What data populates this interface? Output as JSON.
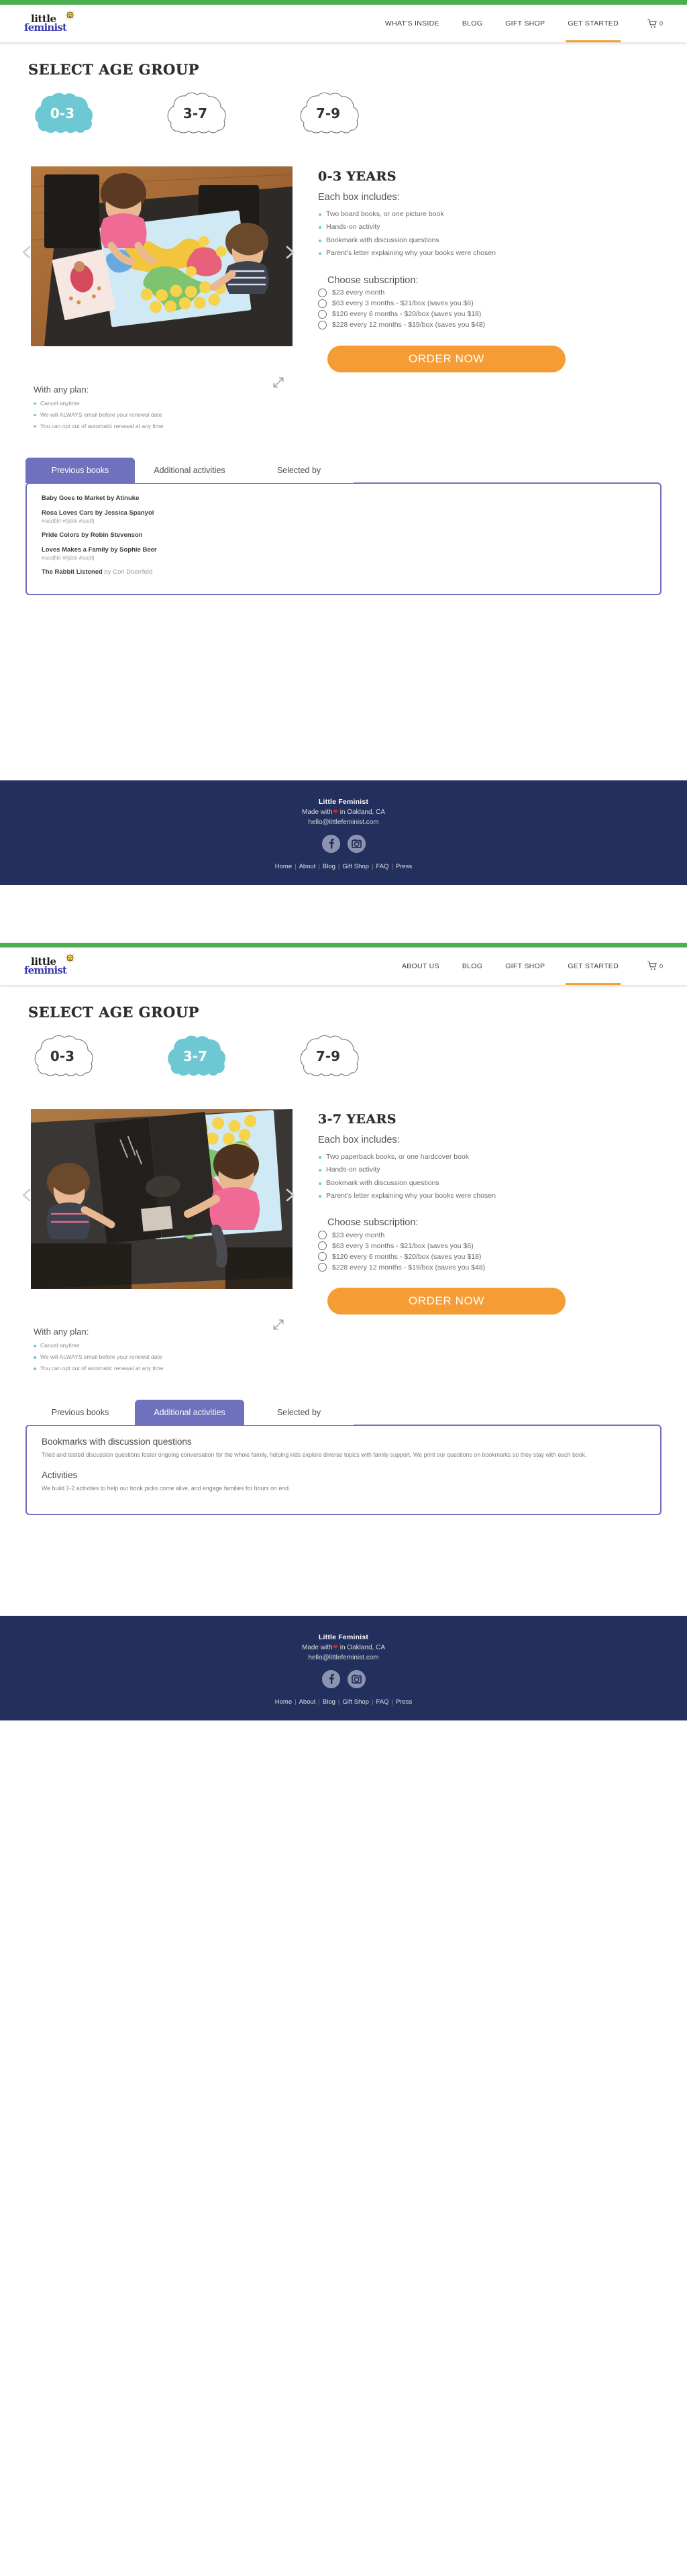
{
  "brand": {
    "name_line1": "little",
    "name_line2": "feminist",
    "sun_icon": "sun-icon"
  },
  "sections": [
    {
      "id": "section-0-3",
      "nav": {
        "items": [
          {
            "label": "WHAT'S INSIDE",
            "active": false
          },
          {
            "label": "BLOG",
            "active": false
          },
          {
            "label": "GIFT SHOP",
            "active": false
          },
          {
            "label": "GET STARTED",
            "active": true
          }
        ],
        "cart_icon": "cart-icon",
        "cart_count": "0"
      },
      "select_title": "SELECT AGE GROUP",
      "age_groups": [
        {
          "label": "0-3",
          "selected": true
        },
        {
          "label": "3-7",
          "selected": false
        },
        {
          "label": "7-9",
          "selected": false
        }
      ],
      "gallery": {
        "prev_icon": "chevron-left-icon",
        "next_icon": "chevron-right-icon",
        "expand_icon": "expand-icon",
        "alt": "Two toddlers at a dark table playing with a colorful world map activity poster and a picture book"
      },
      "product": {
        "title": "0-3 YEARS",
        "subhead": "Each box includes:",
        "features": [
          "Two board books, or one picture book",
          "Hands-on activity",
          "Bookmark with discussion questions",
          "Parent's letter explaining why your books were chosen"
        ],
        "choose_label": "Choose subscription:",
        "plans": [
          {
            "label": "$23 every month",
            "selected": false
          },
          {
            "label": "$63 every 3 months - $21/box (saves you $6)",
            "selected": false
          },
          {
            "label": "$120 every 6 months  - $20/box (saves you $18)",
            "selected": false
          },
          {
            "label": "$228 every 12 months - $19/box (saves you $48)",
            "selected": false
          }
        ],
        "order_label": "ORDER NOW"
      },
      "anyplan": {
        "title": "With any plan:",
        "items": [
          "Cancel anytime",
          "We will ALWAYS email before your renewal date",
          "You can opt out of automatic renewal at any time"
        ]
      },
      "tabs": [
        {
          "label": "Previous books",
          "active": true
        },
        {
          "label": "Additional activities",
          "active": false
        },
        {
          "label": "Selected by",
          "active": false
        }
      ],
      "panel_kind": "books",
      "books": [
        {
          "title": "Baby Goes to Market by Atinuke",
          "tags": ""
        },
        {
          "title": "Rosa Loves Cars by Jessica Spanyol",
          "tags": "#asdfjkl #fjdsk #asdfj"
        },
        {
          "title": "Pride Colors by Robin Stevenson",
          "tags": ""
        },
        {
          "title": "Loves Makes a Family by Sophie Beer",
          "tags": "#asdfjkl #fjdsk #asdfj"
        },
        {
          "title": "The Rabbit Listened",
          "by": " by Cori Doerrfeld",
          "tags": ""
        }
      ]
    },
    {
      "id": "section-3-7",
      "nav": {
        "items": [
          {
            "label": "ABOUT US",
            "active": false
          },
          {
            "label": "BLOG",
            "active": false
          },
          {
            "label": "GIFT SHOP",
            "active": false
          },
          {
            "label": "GET STARTED",
            "active": true
          }
        ],
        "cart_icon": "cart-icon",
        "cart_count": "0"
      },
      "select_title": "SELECT AGE GROUP",
      "age_groups": [
        {
          "label": "0-3",
          "selected": false
        },
        {
          "label": "3-7",
          "selected": true
        },
        {
          "label": "7-9",
          "selected": false
        }
      ],
      "gallery": {
        "prev_icon": "chevron-left-icon",
        "next_icon": "chevron-right-icon",
        "expand_icon": "expand-icon",
        "alt": "Two children at a dark table with an open hardcover book and a colorful world map activity poster"
      },
      "product": {
        "title": "3-7 YEARS",
        "subhead": "Each box includes:",
        "features": [
          "Two paperback books, or one hardcover book",
          "Hands-on activity",
          "Bookmark with discussion questions",
          "Parent's letter explaining why your books were chosen"
        ],
        "choose_label": "Choose subscription:",
        "plans": [
          {
            "label": "$23 every month",
            "selected": false
          },
          {
            "label": "$63 every 3 months - $21/box (saves you $6)",
            "selected": false
          },
          {
            "label": "$120 every 6 months  - $20/box (saves you $18)",
            "selected": false
          },
          {
            "label": "$228 every 12 months - $19/box (saves you $48)",
            "selected": false
          }
        ],
        "order_label": "ORDER NOW"
      },
      "anyplan": {
        "title": "With any plan:",
        "items": [
          "Cancel anytime",
          "We will ALWAYS email before your renewal date",
          "You can opt out of automatic renewal at any time"
        ]
      },
      "tabs": [
        {
          "label": "Previous books",
          "active": false
        },
        {
          "label": "Additional activities",
          "active": true
        },
        {
          "label": "Selected by",
          "active": false
        }
      ],
      "panel_kind": "activities",
      "activities": [
        {
          "heading": "Bookmarks with discussion questions",
          "body": "Tried and tested discussion questions foster ongoing conversation for the whole family, helping kids explore diverse topics with family support. We print our questions on bookmarks so they stay with each book."
        },
        {
          "heading": "Activities",
          "body": "We build 1-2 activities to help our book picks come alive, and engage families for hours on end."
        }
      ]
    }
  ],
  "footer": {
    "brand": "Little Feminist",
    "made_with_prefix": "Made with",
    "heart_icon": "heart-icon",
    "made_with_suffix": "in Oakland, CA",
    "email": "hello@littlefeminist.com",
    "social": [
      {
        "name": "facebook-icon"
      },
      {
        "name": "instagram-icon"
      }
    ],
    "links": [
      "Home",
      "About",
      "Blog",
      "Gift Shop",
      "FAQ",
      "Press"
    ]
  },
  "colors": {
    "green_bar": "#4CAF50",
    "accent_orange": "#F59C35",
    "cloud_selected": "#6DC8D3",
    "tab_purple": "#6F71BE",
    "footer_navy": "#232F5C",
    "bullet_teal": "#6CC9D1"
  }
}
